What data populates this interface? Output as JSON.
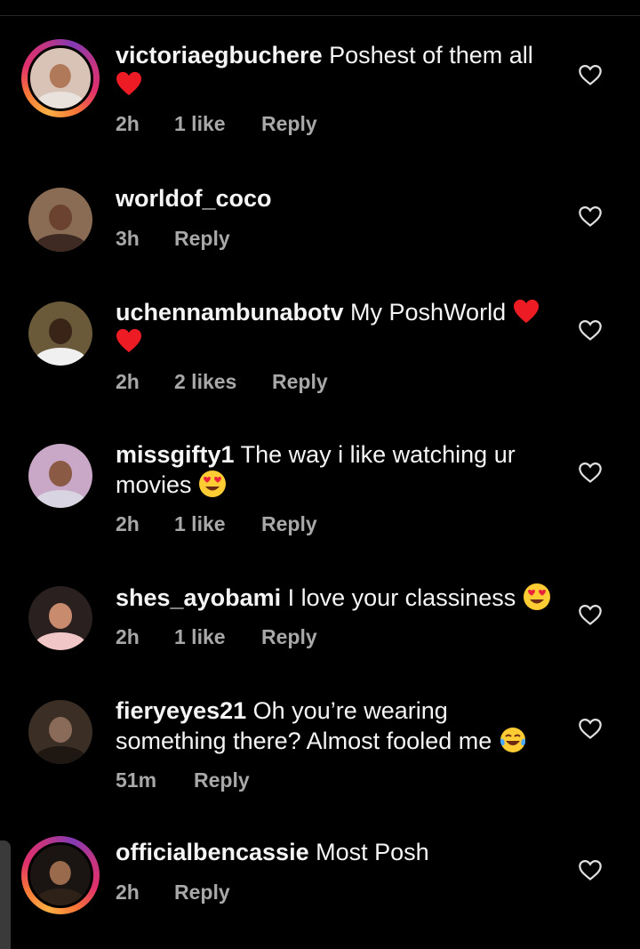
{
  "colors": {
    "background": "#000000",
    "text": "#f5f5f5",
    "meta_text": "#a8a8a8",
    "heart_red": "#ed1c24"
  },
  "comments": [
    {
      "username": "victoriaegbuchere",
      "text": "Poshest of them all",
      "emoji": "red-heart",
      "time": "2h",
      "likes": "1 like",
      "reply": "Reply",
      "has_story": true
    },
    {
      "username": "worldof_coco",
      "text": "",
      "time": "3h",
      "likes": "",
      "reply": "Reply",
      "has_story": false
    },
    {
      "username": "uchennambunabotv",
      "text": "My PoshWorld",
      "emoji": "red-heart x2",
      "time": "2h",
      "likes": "2 likes",
      "reply": "Reply",
      "has_story": false
    },
    {
      "username": "missgifty1",
      "text": "The way i like watching ur movies",
      "emoji": "heart-eyes",
      "time": "2h",
      "likes": "1 like",
      "reply": "Reply",
      "has_story": false
    },
    {
      "username": "shes_ayobami",
      "text": "I love your classiness",
      "emoji": "heart-eyes",
      "time": "2h",
      "likes": "1 like",
      "reply": "Reply",
      "has_story": false
    },
    {
      "username": "fieryeyes21",
      "text": "Oh you’re wearing something there? Almost fooled me",
      "emoji": "tears-of-joy",
      "time": "51m",
      "likes": "",
      "reply": "Reply",
      "has_story": false
    },
    {
      "username": "officialbencassie",
      "text": "Most Posh",
      "time": "2h",
      "likes": "",
      "reply": "Reply",
      "has_story": true
    }
  ],
  "icons": {
    "like": "heart-outline-icon"
  }
}
